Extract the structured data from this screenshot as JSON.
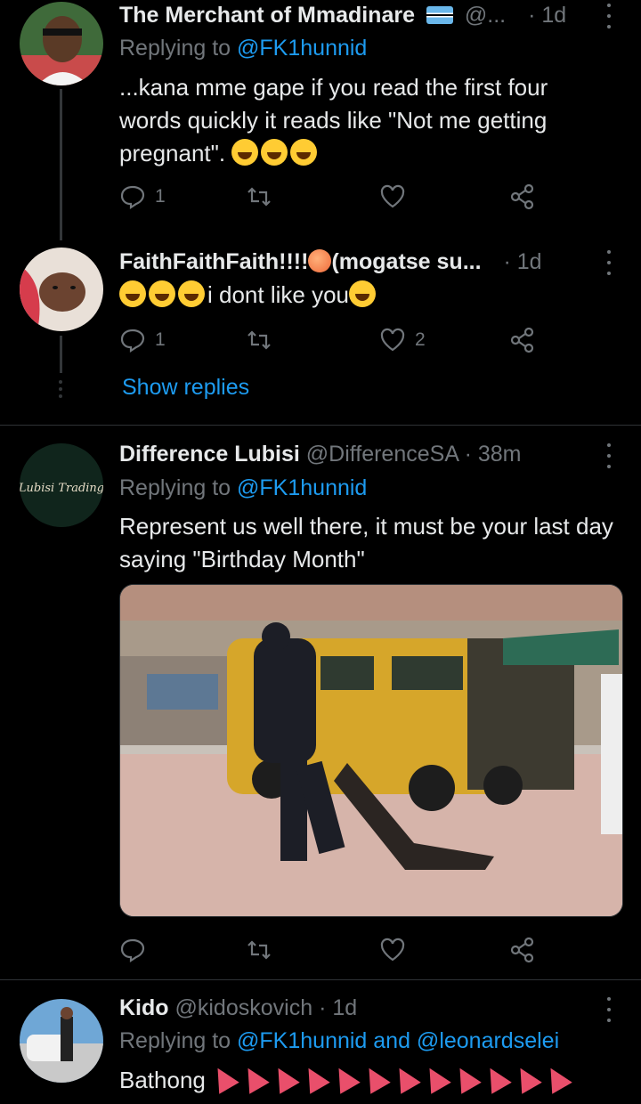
{
  "tweets": [
    {
      "name": "The Merchant of Mmadinare",
      "handle": "@...",
      "time": "· 1d",
      "replying_label": "Replying to",
      "replying_to": "@FK1hunnid",
      "text": "...kana mme gape if you read the first four words quickly it reads like \"Not me getting pregnant\".",
      "reply_count": "1",
      "retweet_count": "",
      "like_count": ""
    },
    {
      "name": "FaithFaithFaith!!!!",
      "name_suffix": "(mogatse su...",
      "time": "· 1d",
      "text": "i dont like you",
      "reply_count": "1",
      "retweet_count": "",
      "like_count": "2",
      "show_replies": "Show replies"
    },
    {
      "name": "Difference Lubisi",
      "handle": "@DifferenceSA",
      "time": "· 38m",
      "replying_label": "Replying to",
      "replying_to": "@FK1hunnid",
      "text": "Represent us well there, it must be your last day saying \"Birthday Month\"",
      "reply_count": "",
      "retweet_count": "",
      "like_count": ""
    },
    {
      "name": "Kido",
      "handle": "@kidoskovich",
      "time": "· 1d",
      "replying_label": "Replying to",
      "replying_to": "@FK1hunnid and @leonardselei",
      "text": "Bathong"
    }
  ],
  "avatar_logo_text": "Lubisi Trading",
  "colors": {
    "accent": "#1d9bf0",
    "muted": "#71767b",
    "background": "#000000",
    "text": "#e7e9ea"
  },
  "icons": [
    "reply-icon",
    "retweet-icon",
    "like-icon",
    "share-icon",
    "more-icon",
    "flag-icon"
  ]
}
